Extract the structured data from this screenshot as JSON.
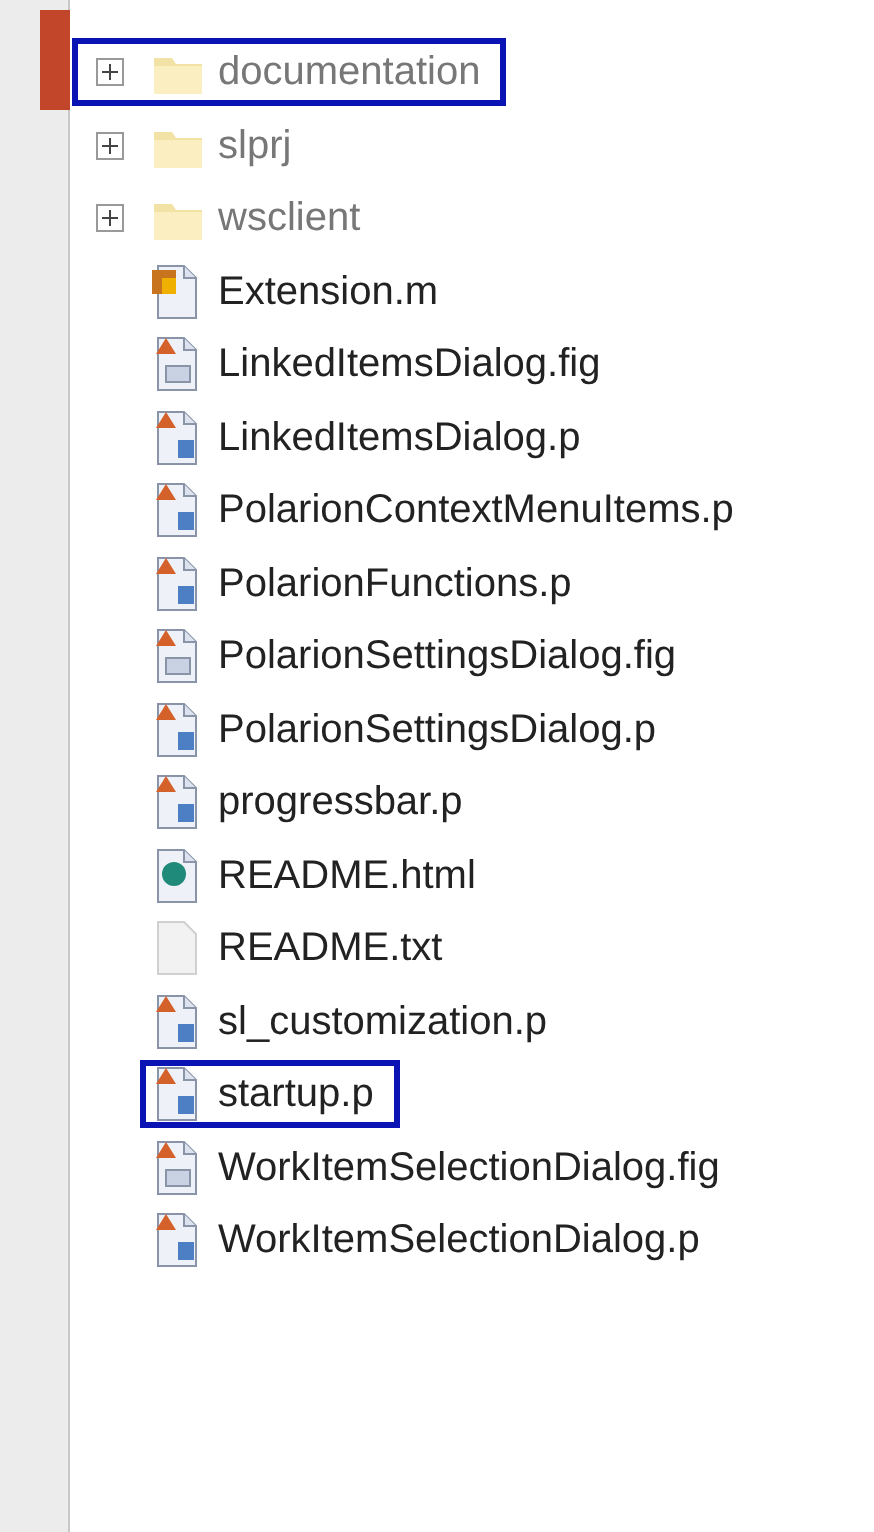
{
  "tree": {
    "items": [
      {
        "kind": "folder",
        "label": "documentation",
        "expanded": false,
        "highlighted": true
      },
      {
        "kind": "folder",
        "label": "slprj",
        "expanded": false,
        "highlighted": false
      },
      {
        "kind": "folder",
        "label": "wsclient",
        "expanded": false,
        "highlighted": false
      },
      {
        "kind": "mfile",
        "label": "Extension.m",
        "highlighted": false
      },
      {
        "kind": "fig",
        "label": "LinkedItemsDialog.fig",
        "highlighted": false
      },
      {
        "kind": "pfile",
        "label": "LinkedItemsDialog.p",
        "highlighted": false
      },
      {
        "kind": "pfile",
        "label": "PolarionContextMenuItems.p",
        "highlighted": false
      },
      {
        "kind": "pfile",
        "label": "PolarionFunctions.p",
        "highlighted": false
      },
      {
        "kind": "fig",
        "label": "PolarionSettingsDialog.fig",
        "highlighted": false
      },
      {
        "kind": "pfile",
        "label": "PolarionSettingsDialog.p",
        "highlighted": false
      },
      {
        "kind": "pfile",
        "label": "progressbar.p",
        "highlighted": false
      },
      {
        "kind": "html",
        "label": "README.html",
        "highlighted": false
      },
      {
        "kind": "txt",
        "label": "README.txt",
        "highlighted": false
      },
      {
        "kind": "pfile",
        "label": "sl_customization.p",
        "highlighted": false
      },
      {
        "kind": "pfile",
        "label": "startup.p",
        "highlighted": true
      },
      {
        "kind": "fig",
        "label": "WorkItemSelectionDialog.fig",
        "highlighted": false
      },
      {
        "kind": "pfile",
        "label": "WorkItemSelectionDialog.p",
        "highlighted": false
      }
    ]
  }
}
